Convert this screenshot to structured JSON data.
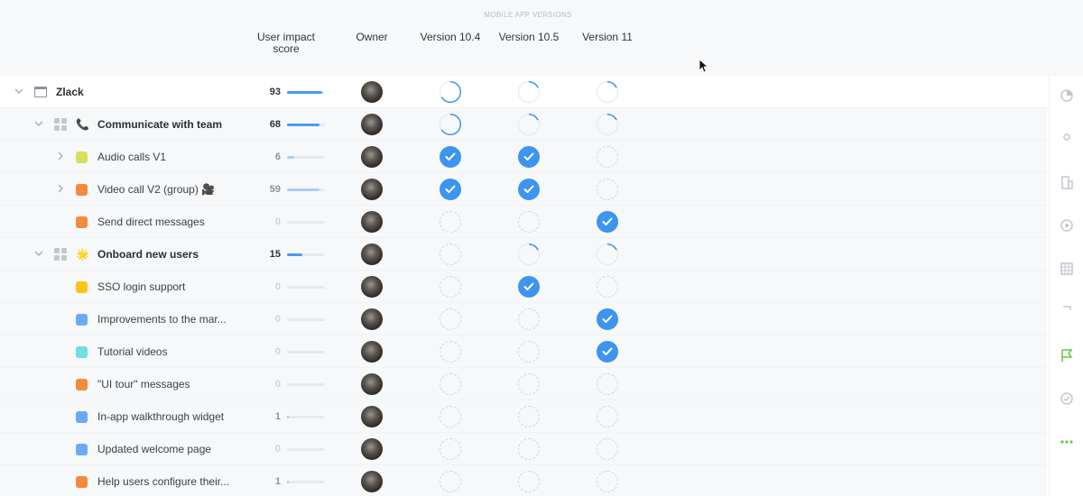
{
  "header": {
    "group_label": "MOBILE APP VERSIONS",
    "columns": {
      "impact": "User impact score",
      "owner": "Owner",
      "v1": "Version 10.4",
      "v2": "Version 10.5",
      "v3": "Version 11"
    }
  },
  "rows": [
    {
      "level": 0,
      "name": "Zlack",
      "icon": "window-icon",
      "score": "93",
      "fill": 0.93,
      "chevron": "chevron-down",
      "statuses": [
        "progress",
        "progress",
        "progress"
      ]
    },
    {
      "level": 1,
      "name": "Communicate with team",
      "icon": "phone-icon",
      "emoji": "📞",
      "score": "68",
      "fill": 0.85,
      "chevron": "chevron-down",
      "statuses": [
        "progress",
        "progress",
        "progress"
      ]
    },
    {
      "level": 2,
      "name": "Audio calls V1",
      "color": "#d4e157",
      "score": "6",
      "fill": 0.2,
      "chevron": "chevron-right",
      "statuses": [
        "done",
        "done",
        "empty"
      ]
    },
    {
      "level": 2,
      "name": "Video call V2 (group) 🎥",
      "color": "#f58a3a",
      "score": "59",
      "fill": 0.85,
      "chevron": "chevron-right",
      "statuses": [
        "done",
        "done",
        "empty"
      ]
    },
    {
      "level": 2,
      "name": "Send direct messages",
      "color": "#f58a3a",
      "score": "0",
      "fill": 0,
      "chevron": "",
      "statuses": [
        "empty",
        "empty",
        "done"
      ]
    },
    {
      "level": 1,
      "name": "Onboard new users",
      "icon": "star-icon",
      "emoji": "🌟",
      "score": "15",
      "fill": 0.4,
      "chevron": "chevron-down",
      "statuses": [
        "empty",
        "progress",
        "progress"
      ]
    },
    {
      "level": 2,
      "name": "SSO login support",
      "color": "#fcc419",
      "score": "0",
      "fill": 0,
      "chevron": "",
      "statuses": [
        "empty",
        "done",
        "empty"
      ]
    },
    {
      "level": 2,
      "name": "Improvements to the mar...",
      "color": "#6aaaf5",
      "score": "0",
      "fill": 0,
      "chevron": "",
      "statuses": [
        "empty",
        "empty",
        "done"
      ]
    },
    {
      "level": 2,
      "name": "Tutorial videos",
      "color": "#6fe0e0",
      "score": "0",
      "fill": 0,
      "chevron": "",
      "statuses": [
        "empty",
        "empty",
        "done"
      ]
    },
    {
      "level": 2,
      "name": "\"UI tour\" messages",
      "color": "#f58a3a",
      "score": "0",
      "fill": 0,
      "chevron": "",
      "statuses": [
        "empty",
        "empty",
        "empty"
      ]
    },
    {
      "level": 2,
      "name": "In-app walkthrough widget",
      "color": "#6aaaf5",
      "score": "1",
      "fill": 0.05,
      "chevron": "",
      "statuses": [
        "empty",
        "empty",
        "empty"
      ]
    },
    {
      "level": 2,
      "name": "Updated welcome page",
      "color": "#6aaaf5",
      "score": "0",
      "fill": 0,
      "chevron": "",
      "statuses": [
        "empty",
        "empty",
        "empty"
      ]
    },
    {
      "level": 2,
      "name": "Help users configure their...",
      "color": "#f58a3a",
      "score": "1",
      "fill": 0.05,
      "chevron": "",
      "statuses": [
        "empty",
        "empty",
        "empty"
      ]
    }
  ],
  "rail": [
    {
      "icon": "pie-chart-icon",
      "color": "#c3c7cd"
    },
    {
      "icon": "user-icon",
      "color": "#c3c7cd"
    },
    {
      "icon": "building-icon",
      "color": "#c3c7cd"
    },
    {
      "icon": "target-icon",
      "color": "#c3c7cd"
    },
    {
      "icon": "table-icon",
      "color": "#c3c7cd"
    },
    {
      "icon": "trophy-icon",
      "color": "#c3c7cd"
    },
    {
      "icon": "flag-icon",
      "color": "#6cc644"
    },
    {
      "icon": "check-circle-icon",
      "color": "#c3c7cd"
    },
    {
      "icon": "more-icon",
      "color": "#6cc644"
    }
  ],
  "colors": {
    "accent": "#3d95ee",
    "bar": "#4a9af0",
    "active": "#6cc644"
  }
}
